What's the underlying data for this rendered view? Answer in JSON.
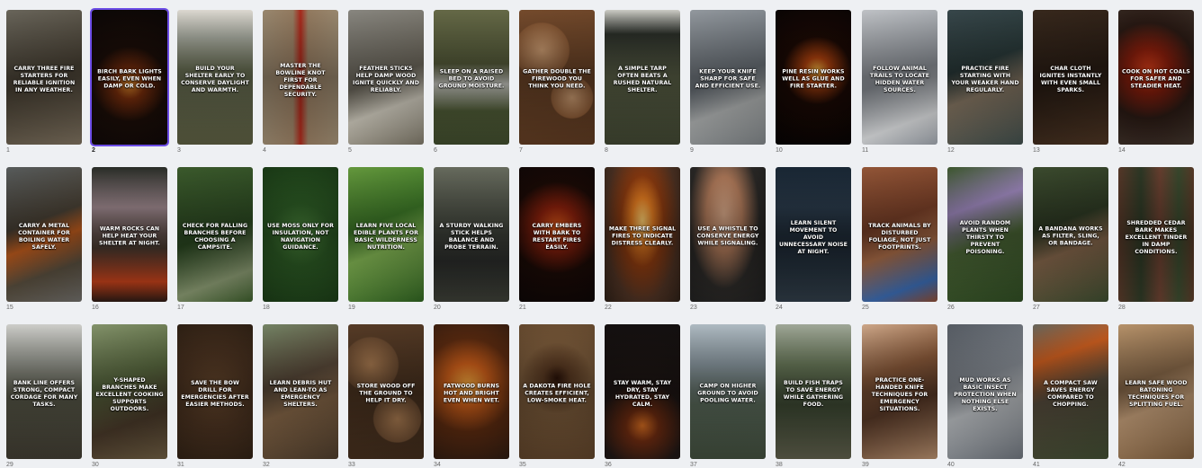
{
  "accent": "#6b4ce6",
  "selected_index": 2,
  "cards": [
    {
      "number": "1",
      "caption": "CARRY THREE FIRE STARTERS FOR RELIABLE IGNITION IN ANY WEATHER.",
      "bg": "linear-gradient(160deg,#6e6a5f,#4a4235 50%,#7a6e5c)"
    },
    {
      "number": "2",
      "caption": "BIRCH BARK LIGHTS EASILY, EVEN WHEN DAMP OR COLD.",
      "bg": "radial-gradient(circle at 50% 55%,#e08a2a 0%,#7a2e0c 18%,#1a0d08 45%,#0b0706 100%)"
    },
    {
      "number": "3",
      "caption": "BUILD YOUR SHELTER EARLY TO CONSERVE DAYLIGHT AND WARMTH.",
      "bg": "linear-gradient(180deg,#e8e4dc 0%,#a8aba0 20%,#6c7256 45%,#5a5c40 100%)"
    },
    {
      "number": "4",
      "caption": "MASTER THE BOWLINE KNOT FIRST FOR DEPENDABLE SECURITY.",
      "bg": "linear-gradient(90deg,#a08e74 0%,#9a8064 40%,#b02a1c 50%,#9a8064 60%,#a08e74 100%)"
    },
    {
      "number": "5",
      "caption": "FEATHER STICKS HELP DAMP WOOD IGNITE QUICKLY AND RELIABLY.",
      "bg": "linear-gradient(160deg,#8f8d86,#6f6a5e 50%,#d9d4c6 70%,#7a7465)"
    },
    {
      "number": "6",
      "caption": "SLEEP ON A RAISED BED TO AVOID GROUND MOISTURE.",
      "bg": "linear-gradient(180deg,#6a6e4a 0%,#555b3a 40%,#cfcfc8 55%,#4e5a36 75%,#3e4a2c 100%)"
    },
    {
      "number": "7",
      "caption": "GATHER DOUBLE THE FIREWOOD YOU THINK YOU NEED.",
      "bg": "radial-gradient(circle at 30% 30%,#c99a70 0%,#8a5a36 25%,transparent 26%),radial-gradient(circle at 70% 65%,#c99a70 0%,#8a5a36 20%,transparent 21%),linear-gradient(160deg,#7a4e2e,#5a3820)"
    },
    {
      "number": "8",
      "caption": "A SIMPLE TARP OFTEN BEATS A RUSHED NATURAL SHELTER.",
      "bg": "linear-gradient(180deg,#d6d6cf 0%,#2a2e28 18%,#5c6248 50%,#3e4430 100%)"
    },
    {
      "number": "9",
      "caption": "KEEP YOUR KNIFE SHARP FOR SAFE AND EFFICIENT USE.",
      "bg": "linear-gradient(160deg,#9aa0a6,#6c737a 50%,#b5b8b8 70%,#7a7f82)"
    },
    {
      "number": "10",
      "caption": "PINE RESIN WORKS WELL AS GLUE AND FIRE STARTER.",
      "bg": "radial-gradient(circle at 55% 45%,#f5b340 0%,#b0420e 15%,#1a0904 40%,#050303 100%)"
    },
    {
      "number": "11",
      "caption": "FOLLOW ANIMAL TRAILS TO LOCATE HIDDEN WATER SOURCES.",
      "bg": "linear-gradient(160deg,#c9ccd0,#8e939a 50%,#e4e6e8 80%,#9aa0a8)"
    },
    {
      "number": "12",
      "caption": "PRACTICE FIRE STARTING WITH YOUR WEAKER HAND REGULARLY.",
      "bg": "linear-gradient(160deg,#3a4a4e,#2a3a3a 40%,#8a7a66 60%,#3e4c4a)"
    },
    {
      "number": "13",
      "caption": "CHAR CLOTH IGNITES INSTANTLY WITH EVEN SMALL SPARKS.",
      "bg": "linear-gradient(160deg,#3a2a1e,#2a1d14 50%,#4a3322)"
    },
    {
      "number": "14",
      "caption": "COOK ON HOT COALS FOR SAFER AND STEADIER HEAT.",
      "bg": "radial-gradient(circle at 40% 45%,#e0401a 0%,#8a1e0c 25%,#2a1a14 55%,#40342c 100%)"
    },
    {
      "number": "15",
      "caption": "CARRY A METAL CONTAINER FOR BOILING WATER SAFELY.",
      "bg": "linear-gradient(160deg,#5c6060,#4a4236 40%,#d06420 55%,#5a5040 75%,#6c6a66)"
    },
    {
      "number": "16",
      "caption": "WARM ROCKS CAN HELP HEAT YOUR SHELTER AT NIGHT.",
      "bg": "linear-gradient(180deg,#2a2e28 0%,#a08a90 30%,#4a3a30 60%,#c0401a 85%,#2a1a14 100%)"
    },
    {
      "number": "17",
      "caption": "CHECK FOR FALLING BRANCHES BEFORE CHOOSING A CAMPSITE.",
      "bg": "linear-gradient(160deg,#3e5e2e,#2c4a22 50%,#8a9a72 80%,#3a5a2a)"
    },
    {
      "number": "18",
      "caption": "USE MOSS ONLY FOR INSULATION, NOT NAVIGATION GUIDANCE.",
      "bg": "radial-gradient(circle at 50% 50%,#4e8a3e 0%,#2c5a24 40%,#1a3a16 100%)"
    },
    {
      "number": "19",
      "caption": "LEARN FIVE LOCAL EDIBLE PLANTS FOR BASIC WILDERNESS NUTRITION.",
      "bg": "linear-gradient(160deg,#6aa040,#3e7a28 40%,#8ac058 60%,#2e6020)"
    },
    {
      "number": "20",
      "caption": "A STURDY WALKING STICK HELPS BALANCE AND PROBE TERRAIN.",
      "bg": "linear-gradient(180deg,#6c7062 0%,#4a4e44 40%,#2a2c2a 70%,#3a3c34 100%)"
    },
    {
      "number": "21",
      "caption": "CARRY EMBERS WITH BARK TO RESTART FIRES EASILY.",
      "bg": "radial-gradient(circle at 50% 45%,#e05a1a 0%,#8a200c 25%,#1a0a06 55%,#0c0606 100%)"
    },
    {
      "number": "22",
      "caption": "MAKE THREE SIGNAL FIRES TO INDICATE DISTRESS CLEARLY.",
      "bg": "radial-gradient(ellipse at 50% 40%,#ffd070 0%,#e07a20 20%,#8a3a10 40%,#4a3022 70%,#2a1e16 100%)"
    },
    {
      "number": "23",
      "caption": "USE A WHISTLE TO CONSERVE ENERGY WHILE SIGNALING.",
      "bg": "radial-gradient(ellipse at 45% 35%,#d8a888 0%,#b07a5a 30%,#2a2826 60%,#1e1e1e 100%)"
    },
    {
      "number": "24",
      "caption": "LEARN SILENT MOVEMENT TO AVOID UNNECESSARY NOISE AT NIGHT.",
      "bg": "linear-gradient(180deg,#1a2836 0%,#2a3a4a 30%,#1e2a36 60%,#2e3a44 100%)"
    },
    {
      "number": "25",
      "caption": "TRACK ANIMALS BY DISTURBED FOLIAGE, NOT JUST FOOTPRINTS.",
      "bg": "linear-gradient(160deg,#9a5a3a,#7a4028 40%,#b0704a 60%,#3a6ab0 85%,#8a4a30)"
    },
    {
      "number": "26",
      "caption": "AVOID RANDOM PLANTS WHEN THIRSTY TO PREVENT POISONING.",
      "bg": "linear-gradient(160deg,#3e5a2e,#a08ac0 30%,#4e6a38 55%,#2e4a22)"
    },
    {
      "number": "27",
      "caption": "A BANDANA WORKS AS FILTER, SLING, OR BANDAGE.",
      "bg": "linear-gradient(160deg,#3e4e30,#2e3a24 40%,#8a6a4e 60%,#3a4a2e)"
    },
    {
      "number": "28",
      "caption": "SHREDDED CEDAR BARK MAKES EXCELLENT TINDER IN DAMP CONDITIONS.",
      "bg": "linear-gradient(90deg,#5a3a2a 0%,#2e3a26 30%,#6a4030 55%,#3a4a2e 80%,#5a3a28 100%)"
    },
    {
      "number": "29",
      "caption": "BANK LINE OFFERS STRONG, COMPACT CORDAGE FOR MANY TASKS.",
      "bg": "linear-gradient(180deg,#d8d8d4 0%,#a0a29a 25%,#5a5a4a 55%,#3e3a30 100%)"
    },
    {
      "number": "30",
      "caption": "Y-SHAPED BRANCHES MAKE EXCELLENT COOKING SUPPORTS OUTDOORS.",
      "bg": "linear-gradient(160deg,#8a9a70,#5a6a40 40%,#4a3a2a 70%,#6a5a40)"
    },
    {
      "number": "31",
      "caption": "SAVE THE BOW DRILL FOR EMERGENCIES AFTER EASIER METHODS.",
      "bg": "radial-gradient(circle at 50% 50%,#6a4a2e 0%,#4a3220 50%,#2e2014 100%)"
    },
    {
      "number": "32",
      "caption": "LEARN DEBRIS HUT AND LEAN-TO AS EMERGENCY SHELTERS.",
      "bg": "linear-gradient(160deg,#7a8a6a,#5a4a3a 40%,#8a6a4a 60%,#4a3a2a)"
    },
    {
      "number": "33",
      "caption": "STORE WOOD OFF THE GROUND TO HELP IT DRY.",
      "bg": "radial-gradient(circle at 30% 30%,#a87a50 0%,#6a4a30 25%,transparent 26%),radial-gradient(circle at 65% 70%,#a87a50 0%,#6a4a30 22%,transparent 23%),linear-gradient(160deg,#5a3e28,#3e2a1a)"
    },
    {
      "number": "34",
      "caption": "FATWOOD BURNS HOT AND BRIGHT EVEN WHEN WET.",
      "bg": "radial-gradient(circle at 45% 45%,#ffb040 0%,#d0601a 25%,#5a2a10 55%,#2a1a10 100%)"
    },
    {
      "number": "35",
      "caption": "A DAKOTA FIRE HOLE CREATES EFFICIENT, LOW-SMOKE HEAT.",
      "bg": "radial-gradient(circle at 50% 40%,#2a1208 0%,#5a3a22 15%,#7a5a3a 40%,#5a4028 100%)"
    },
    {
      "number": "36",
      "caption": "STAY WARM, STAY DRY, STAY HYDRATED, STAY CALM.",
      "bg": "radial-gradient(circle at 50% 75%,#d06a20 0%,#6a2a10 15%,#1e1614 40%,#141010 100%)"
    },
    {
      "number": "37",
      "caption": "CAMP ON HIGHER GROUND TO AVOID POOLING WATER.",
      "bg": "linear-gradient(180deg,#b8c4cc 0%,#8a98a0 30%,#5a6a5a 60%,#3e4a3a 100%)"
    },
    {
      "number": "38",
      "caption": "BUILD FISH TRAPS TO SAVE ENERGY WHILE GATHERING FOOD.",
      "bg": "linear-gradient(180deg,#a8b0a0 0%,#6a7a5a 30%,#3e4a34 60%,#5a5a48 100%)"
    },
    {
      "number": "39",
      "caption": "PRACTICE ONE-HANDED KNIFE TECHNIQUES FOR EMERGENCY SITUATIONS.",
      "bg": "linear-gradient(160deg,#d8b090,#8a5a3a 35%,#5a3a28 60%,#b08a6a)"
    },
    {
      "number": "40",
      "caption": "MUD WORKS AS BASIC INSECT PROTECTION WHEN NOTHING ELSE EXISTS.",
      "bg": "linear-gradient(160deg,#5a6068,#8a9098 40%,#c8ccd0 60%,#6a7078)"
    },
    {
      "number": "41",
      "caption": "A COMPACT SAW SAVES ENERGY COMPARED TO CHOPPING.",
      "bg": "linear-gradient(160deg,#6a6a60,#d06020 25%,#5a5040 50%,#3e4a30 100%)"
    },
    {
      "number": "42",
      "caption": "LEARN SAFE WOOD BATONING TECHNIQUES FOR SPLITTING FUEL.",
      "bg": "linear-gradient(160deg,#c09a70,#8a6a4a 40%,#d0a880 60%,#7a5a3a)"
    }
  ]
}
